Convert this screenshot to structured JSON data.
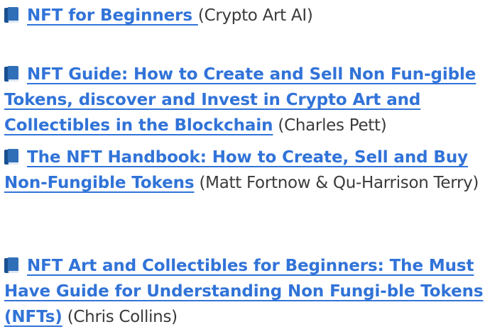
{
  "books": [
    {
      "title": "NFT for Beginners ",
      "author": "(Crypto Art AI)"
    },
    {
      "title": "NFT Guide: How to Create and Sell Non Fun-gible Tokens, discover and Invest in Crypto Art and Collectibles in the Blockchain",
      "author": "(Charles Pett)"
    },
    {
      "title": "The NFT Handbook: How to Create, Sell and Buy Non-Fungible Tokens",
      "author": "(Matt Fortnow & Qu-Harrison Terry)"
    },
    {
      "title": "NFT Art and Collectibles for Beginners: The Must Have Guide for Understanding Non Fungi-ble Tokens (NFTs)",
      "author": "(Chris Collins)"
    }
  ],
  "icon": "book-icon",
  "colors": {
    "link": "#3173d8",
    "text": "#3a3a3a",
    "icon": "#2f6fb8"
  }
}
